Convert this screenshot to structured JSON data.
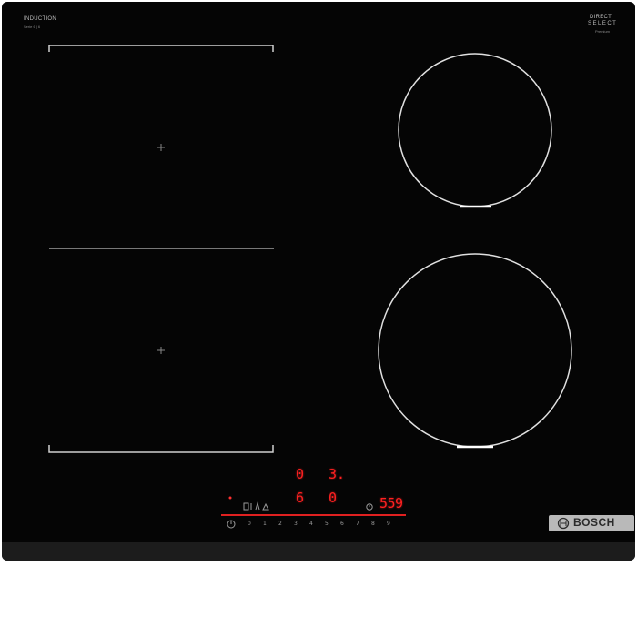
{
  "panel": {
    "series_label": "INDUCTION",
    "series_sublabel": "Serie 6 | 6",
    "badge_line1": "DIRECT",
    "badge_line2": "SELECT",
    "badge_line3": "Premium"
  },
  "displays": {
    "timer_left": "0",
    "timer_right": "3.",
    "power_left": "6",
    "power_right": "0",
    "timer_minutes": "559"
  },
  "power_scale": [
    "0",
    "1",
    "2",
    "3",
    "4",
    "5",
    "6",
    "7",
    "8",
    "9"
  ],
  "brand": {
    "name": "BOSCH",
    "logo_icon": "bosch-armature-logo"
  },
  "colors": {
    "glass": "#050505",
    "display": "#ff2020",
    "plate_outline": "#d9d9d9",
    "badge": "#b9b9b9"
  }
}
